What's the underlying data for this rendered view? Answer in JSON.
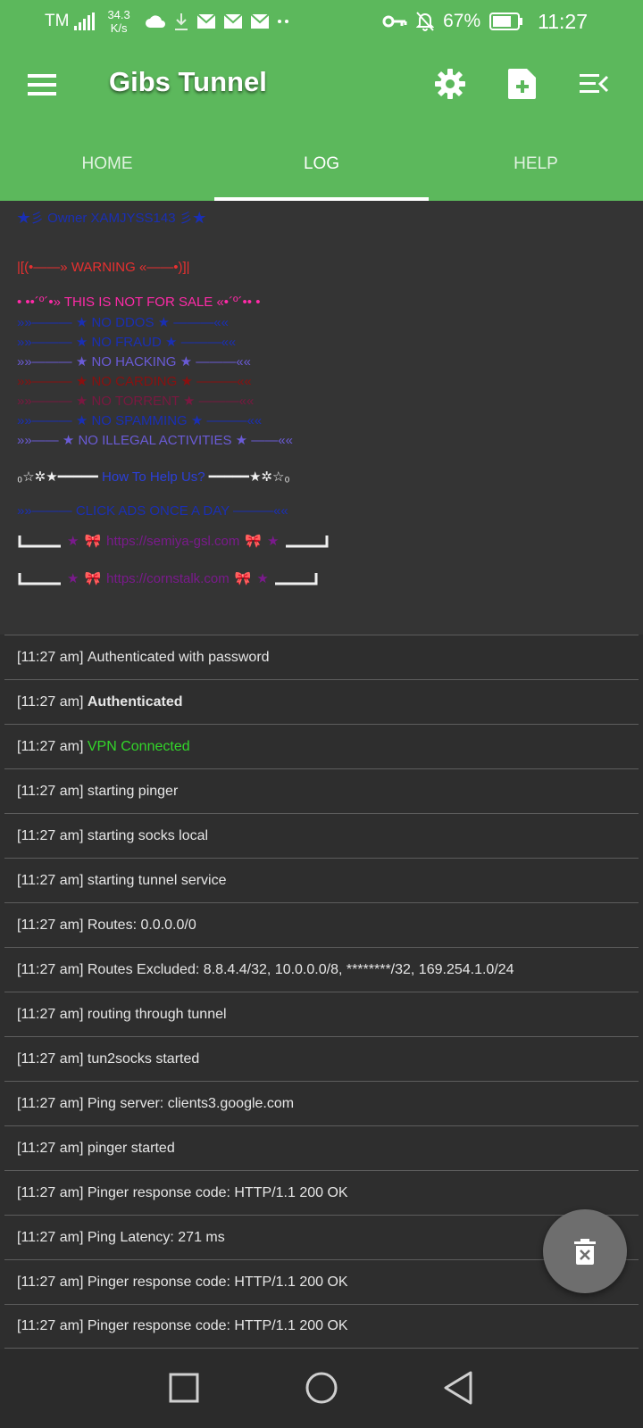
{
  "status_bar": {
    "carrier": "TM",
    "net_speed_value": "34.3",
    "net_speed_unit": "K/s",
    "battery_percent": "67%",
    "time": "11:27",
    "icons": [
      "signal-icon",
      "cloud-icon",
      "download-icon",
      "mail-icon",
      "mail-icon",
      "mail-icon",
      "more-dots-icon",
      "vpn-key-icon",
      "mute-icon",
      "battery-icon"
    ]
  },
  "app_bar": {
    "title": "Gibs Tunnel",
    "icons": [
      "menu-icon",
      "settings-gear-icon",
      "add-file-icon",
      "menu-collapse-icon"
    ]
  },
  "tabs": [
    {
      "label": "HOME",
      "active": false
    },
    {
      "label": "LOG",
      "active": true
    },
    {
      "label": "HELP",
      "active": false
    }
  ],
  "banner": {
    "lines": [
      "★彡 Owner XAMJYSS143 彡★",
      "|[(•——» WARNING «——•)]|",
      "• ••´º´•» THIS IS NOT FOR SALE «•´º´•• •",
      "»»——— ★ NO DDOS ★ ———««",
      "»»——— ★ NO FRAUD ★ ———««",
      "»»——— ★ NO HACKING ★ ———««",
      "»»——— ★ NO CARDING ★ ———««",
      "»»——— ★ NO TORRENT ★ ———««",
      "»»——— ★ NO SPAMMING ★ ———««",
      "»»—— ★ NO ILLEGAL ACTIVITIES ★ ——««",
      "How To Help Us?",
      "»»——— CLICK ADS ONCE A DAY ———««",
      "https://semiya-gsl.com",
      "https://cornstalk.com"
    ],
    "deco_left": "₀☆✲★━━━━━",
    "deco_right": "━━━━━★✲☆₀"
  },
  "log": [
    {
      "time": "[11:27 am]",
      "message": "Authenticated with password",
      "style": "normal"
    },
    {
      "time": "[11:27 am]",
      "message": "Authenticated",
      "style": "bold"
    },
    {
      "time": "[11:27 am]",
      "message": "VPN Connected",
      "style": "green"
    },
    {
      "time": "[11:27 am]",
      "message": "starting pinger",
      "style": "normal"
    },
    {
      "time": "[11:27 am]",
      "message": "starting socks local",
      "style": "normal"
    },
    {
      "time": "[11:27 am]",
      "message": "starting tunnel service",
      "style": "normal"
    },
    {
      "time": "[11:27 am]",
      "message": "Routes: 0.0.0.0/0",
      "style": "normal"
    },
    {
      "time": "[11:27 am]",
      "message": "Routes Excluded: 8.8.4.4/32, 10.0.0.0/8, ********/32, 169.254.1.0/24",
      "style": "normal"
    },
    {
      "time": "[11:27 am]",
      "message": "routing through tunnel",
      "style": "normal"
    },
    {
      "time": "[11:27 am]",
      "message": "tun2socks started",
      "style": "normal"
    },
    {
      "time": "[11:27 am]",
      "message": "Ping server: clients3.google.com",
      "style": "normal"
    },
    {
      "time": "[11:27 am]",
      "message": "pinger started",
      "style": "normal"
    },
    {
      "time": "[11:27 am]",
      "message": "Pinger response code: HTTP/1.1 200 OK",
      "style": "normal"
    },
    {
      "time": "[11:27 am]",
      "message": "Ping Latency: 271 ms",
      "style": "normal"
    },
    {
      "time": "[11:27 am]",
      "message": "Pinger response code: HTTP/1.1 200 OK",
      "style": "normal"
    },
    {
      "time": "[11:27 am]",
      "message": "Pinger response code: HTTP/1.1 200 OK",
      "style": "normal"
    }
  ],
  "fab": {
    "icon": "clear-log-icon"
  },
  "nav_bar": {
    "icons": [
      "recents-square-icon",
      "home-circle-icon",
      "back-triangle-icon"
    ]
  },
  "colors": {
    "app_green": "#5cb85c",
    "background": "#2e2e2e",
    "log_text": "#e6e6e6",
    "connected_green": "#33d62a",
    "warning_red": "#e83030"
  }
}
